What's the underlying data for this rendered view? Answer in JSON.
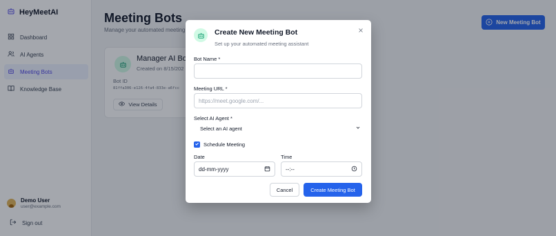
{
  "app": {
    "brand": "HeyMeetAI"
  },
  "sidebar": {
    "items": [
      {
        "label": "Dashboard",
        "icon": "dashboard-grid-icon"
      },
      {
        "label": "AI Agents",
        "icon": "users-icon"
      },
      {
        "label": "Meeting Bots",
        "icon": "bot-icon",
        "active": true
      },
      {
        "label": "Knowledge Base",
        "icon": "book-icon"
      }
    ],
    "user": {
      "name": "Demo User",
      "email": "user@example.com"
    },
    "signout_label": "Sign out"
  },
  "main": {
    "title": "Meeting Bots",
    "subtitle": "Manage your automated meeting",
    "new_button_label": "New Meeting Bot",
    "card": {
      "name": "Manager AI Bot",
      "created": "Created on 8/15/202",
      "id_label": "Bot ID",
      "id_value": "81ffa306-e126-4fa4-833e-a6fcc",
      "view_details_label": "View Details"
    }
  },
  "modal": {
    "title": "Create New Meeting Bot",
    "subtitle": "Set up your automated meeting assistant",
    "bot_name_label": "Bot Name *",
    "bot_name_value": "",
    "meeting_url_label": "Meeting URL *",
    "meeting_url_placeholder": "https://meet.google.com/...",
    "agent_label": "Select AI Agent *",
    "agent_selected": "Select an AI agent",
    "schedule_label": "Schedule Meeting",
    "schedule_checked": true,
    "date_label": "Date",
    "date_value": "dd-mm-yyyy",
    "time_label": "Time",
    "time_value": "--:--",
    "cancel_label": "Cancel",
    "create_label": "Create Meeting Bot"
  },
  "colors": {
    "primary": "#2563eb",
    "bot_icon_bg": "#d1fae5",
    "bot_icon_fg": "#059669",
    "overlay": "rgba(17,24,39,0.38)"
  }
}
